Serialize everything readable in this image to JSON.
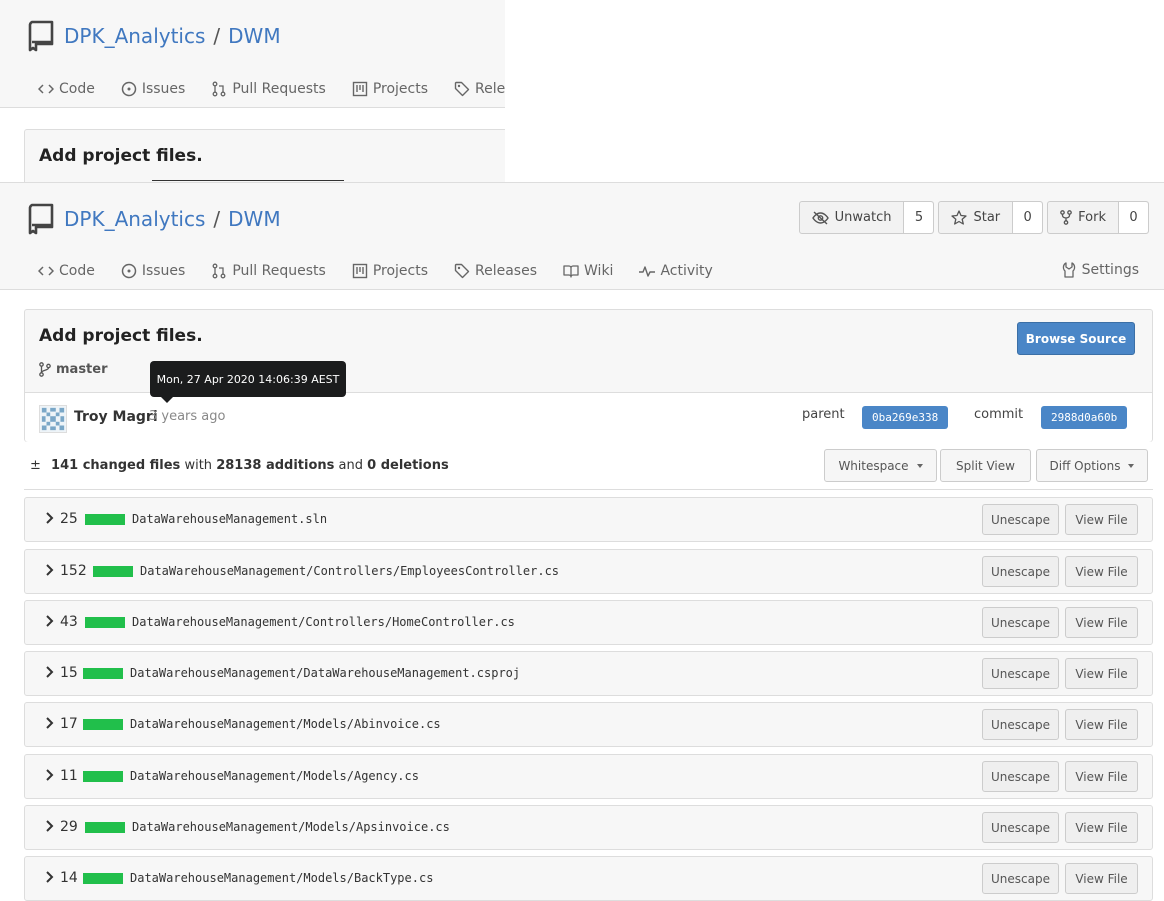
{
  "repo": {
    "owner": "DPK_Analytics",
    "separator": "/",
    "name": "DWM"
  },
  "tabs": [
    {
      "label": "Code",
      "icon": "code-icon"
    },
    {
      "label": "Issues",
      "icon": "issue-icon"
    },
    {
      "label": "Pull Requests",
      "icon": "pull-request-icon"
    },
    {
      "label": "Projects",
      "icon": "project-icon"
    },
    {
      "label": "Releases",
      "icon": "tag-icon"
    },
    {
      "label": "Wiki",
      "icon": "book-icon"
    },
    {
      "label": "Activity",
      "icon": "pulse-icon"
    }
  ],
  "settings_label": "Settings",
  "counters": {
    "watch": {
      "label": "Unwatch",
      "count": "5"
    },
    "star": {
      "label": "Star",
      "count": "0"
    },
    "fork": {
      "label": "Fork",
      "count": "0"
    }
  },
  "commit": {
    "title": "Add project files.",
    "branch": "master",
    "browse_label": "Browse Source",
    "author": "Troy Magri",
    "ago": "3 years ago",
    "tooltip": "Mon, 27 Apr 2020 14:06:39 AEST",
    "parent_label": "parent",
    "parent_sha": "0ba269e338",
    "commit_label": "commit",
    "commit_sha": "2988d0a60b"
  },
  "diff": {
    "pm": "±",
    "changed_count": "141 changed files",
    "with": "with",
    "additions": "28138 additions",
    "and": "and",
    "deletions": "0 deletions",
    "whitespace_label": "Whitespace",
    "split_label": "Split View",
    "options_label": "Diff Options"
  },
  "file_buttons": {
    "unescape": "Unescape",
    "view": "View File"
  },
  "files": [
    {
      "count": "25",
      "path": "DataWarehouseManagement.sln"
    },
    {
      "count": "152",
      "path": "DataWarehouseManagement/Controllers/EmployeesController.cs"
    },
    {
      "count": "43",
      "path": "DataWarehouseManagement/Controllers/HomeController.cs"
    },
    {
      "count": "15",
      "path": "DataWarehouseManagement/DataWarehouseManagement.csproj"
    },
    {
      "count": "17",
      "path": "DataWarehouseManagement/Models/Abinvoice.cs"
    },
    {
      "count": "11",
      "path": "DataWarehouseManagement/Models/Agency.cs"
    },
    {
      "count": "29",
      "path": "DataWarehouseManagement/Models/Apsinvoice.cs"
    },
    {
      "count": "14",
      "path": "DataWarehouseManagement/Models/BackType.cs"
    }
  ],
  "colors": {
    "link": "#4078c0",
    "primary": "#4a86c7",
    "addition_bar": "#21bf4b"
  }
}
